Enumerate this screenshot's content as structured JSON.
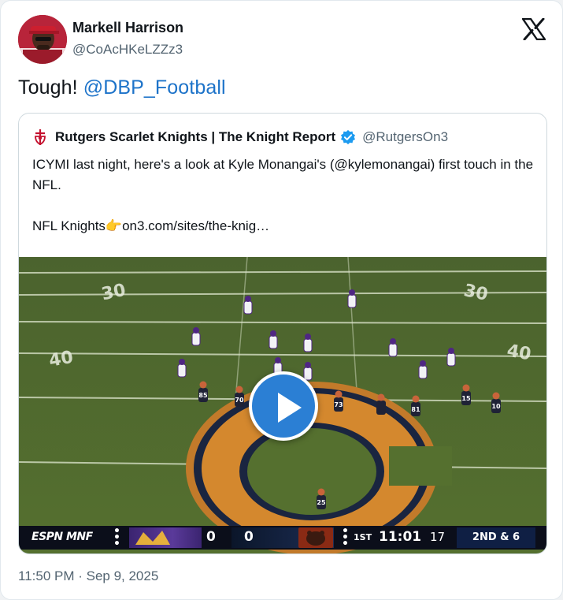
{
  "author": {
    "name": "Markell Harrison",
    "handle": "@CoAcHKeLZZz3"
  },
  "tweet": {
    "text": "Tough!",
    "mention": "@DBP_Football"
  },
  "quoted": {
    "name": "Rutgers Scarlet Knights | The Knight Report",
    "handle": "@RutgersOn3",
    "line1": "ICYMI last night, here's a look at Kyle Monangai's (@kylemonangai) first touch in the NFL.",
    "line2": "NFL Knights👉on3.com/sites/the-knig…",
    "verified": true
  },
  "video": {
    "scoreboard": {
      "network": "ESPN MNF",
      "away_score": "0",
      "home_score": "0",
      "quarter": "1ST",
      "clock": "11:01",
      "play_clock": "17",
      "down_distance": "2ND & 6"
    },
    "field_numbers": [
      "30",
      "30",
      "40",
      "40"
    ],
    "jersey_numbers": [
      "85",
      "70",
      "73",
      "81",
      "15",
      "10",
      "25"
    ]
  },
  "timestamp": "11:50 PM · Sep 9, 2025",
  "colors": {
    "mention": "#1d73c9",
    "verified": "#1d9bf0",
    "play_button": "#2b7fd4",
    "field": "#4a6a2c",
    "vikings": "#4f2683",
    "bears": "#0b162a"
  },
  "icons": [
    "x-logo-icon",
    "verified-badge-icon",
    "rutgers-shield-icon",
    "play-icon"
  ]
}
